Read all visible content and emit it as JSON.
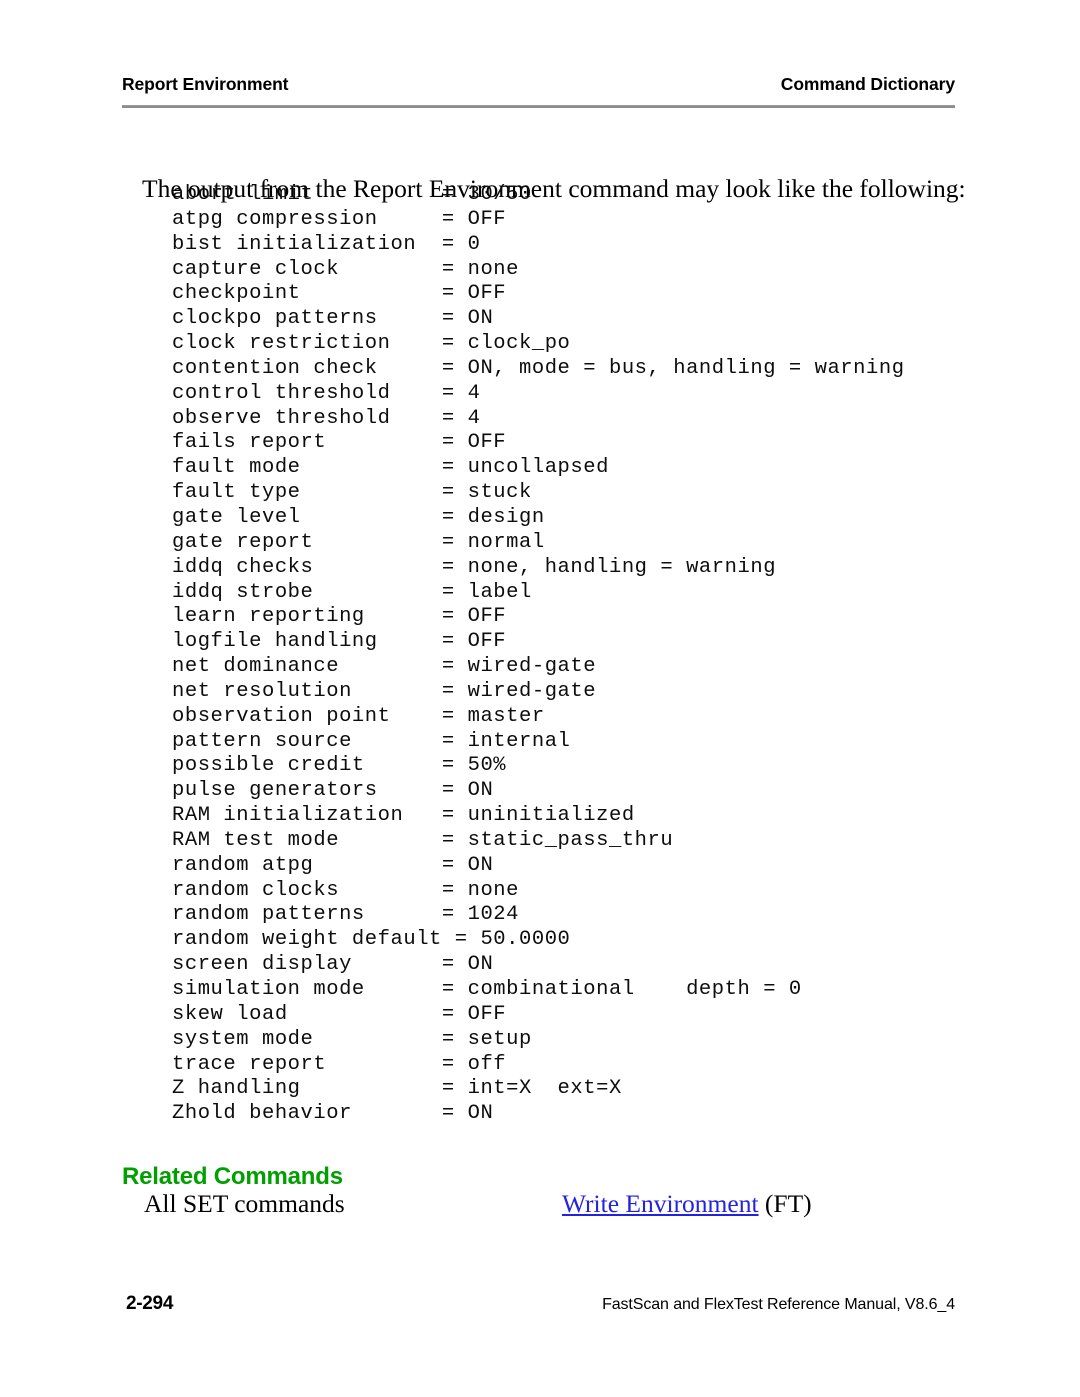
{
  "running_head": {
    "left": "Report Environment",
    "right": "Command Dictionary"
  },
  "body": {
    "intro": "The output from the Report Environment command may look like the following:"
  },
  "listing": {
    "value_column": 21,
    "lines": [
      {
        "label": "abort limit",
        "value": "= 30/50"
      },
      {
        "label": "atpg compression",
        "value": "= OFF"
      },
      {
        "label": "bist initialization",
        "value": "= 0"
      },
      {
        "label": "capture clock",
        "value": "= none"
      },
      {
        "label": "checkpoint",
        "value": "= OFF"
      },
      {
        "label": "clockpo patterns",
        "value": "= ON"
      },
      {
        "label": "clock restriction",
        "value": "= clock_po"
      },
      {
        "label": "contention check",
        "value": "= ON, mode = bus, handling = warning"
      },
      {
        "label": "control threshold",
        "value": "= 4"
      },
      {
        "label": "observe threshold",
        "value": "= 4"
      },
      {
        "label": "fails report",
        "value": "= OFF"
      },
      {
        "label": "fault mode",
        "value": "= uncollapsed"
      },
      {
        "label": "fault type",
        "value": "= stuck"
      },
      {
        "label": "gate level",
        "value": "= design"
      },
      {
        "label": "gate report",
        "value": "= normal"
      },
      {
        "label": "iddq checks",
        "value": "= none, handling = warning"
      },
      {
        "label": "iddq strobe",
        "value": "= label"
      },
      {
        "label": "learn reporting",
        "value": "= OFF"
      },
      {
        "label": "logfile handling",
        "value": "= OFF"
      },
      {
        "label": "net dominance",
        "value": "= wired-gate"
      },
      {
        "label": "net resolution",
        "value": "= wired-gate"
      },
      {
        "label": "observation point",
        "value": "= master"
      },
      {
        "label": "pattern source",
        "value": "= internal"
      },
      {
        "label": "possible credit",
        "value": "= 50%"
      },
      {
        "label": "pulse generators",
        "value": "= ON"
      },
      {
        "label": "RAM initialization",
        "value": "= uninitialized"
      },
      {
        "label": "RAM test mode",
        "value": "= static_pass_thru"
      },
      {
        "label": "random atpg",
        "value": "= ON"
      },
      {
        "label": "random clocks",
        "value": "= none"
      },
      {
        "label": "random patterns",
        "value": "= 1024"
      },
      {
        "label": "random weight default",
        "value": "= 50.0000"
      },
      {
        "label": "screen display",
        "value": "= ON"
      },
      {
        "label": "simulation mode",
        "value": "= combinational    depth = 0"
      },
      {
        "label": "skew load",
        "value": "= OFF"
      },
      {
        "label": "system mode",
        "value": "= setup"
      },
      {
        "label": "trace report",
        "value": "= off"
      },
      {
        "label": "Z handling",
        "value": "= int=X  ext=X"
      },
      {
        "label": "Zhold behavior",
        "value": "= ON"
      }
    ]
  },
  "related_commands": {
    "heading": "Related Commands",
    "left_item": "All SET commands",
    "right_link": "Write Environment",
    "right_suffix": " (FT)"
  },
  "footer": {
    "folio": "2-294",
    "book_title": "FastScan and FlexTest Reference Manual, V8.6_4"
  },
  "colors": {
    "heading_green": "#00a000",
    "link_blue": "#2222e0",
    "rule_gray": "#8c8c8c",
    "text_black": "#000000"
  }
}
